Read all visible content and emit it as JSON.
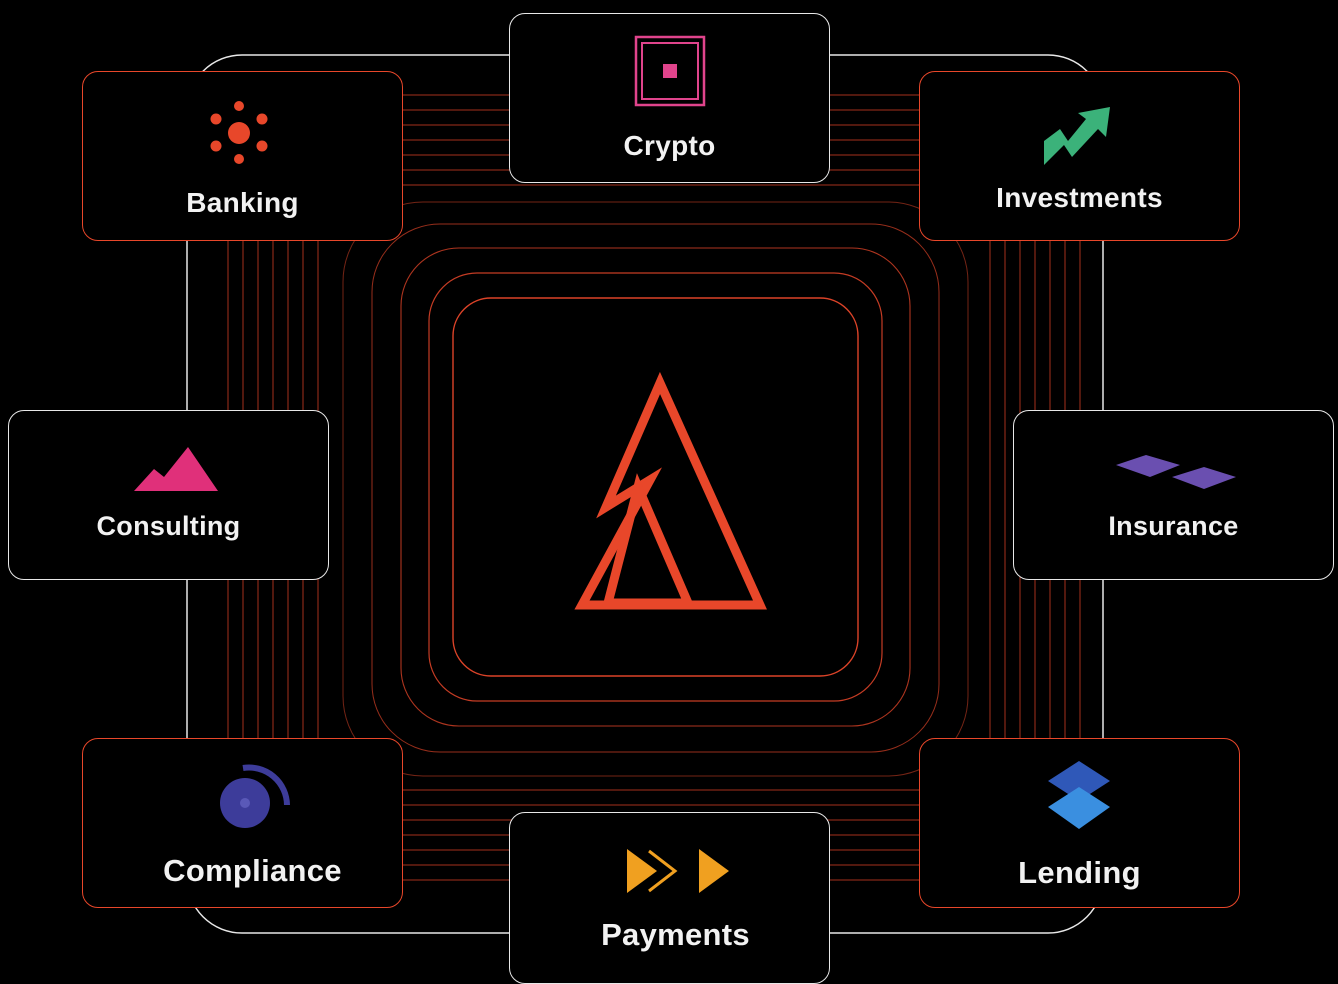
{
  "hub": {
    "logo_icon": "triangle-mark-icon",
    "accent_color": "#e8472a"
  },
  "nodes": [
    {
      "key": "crypto",
      "label": "Crypto",
      "icon": "nested-square-icon",
      "color": "#e0448c"
    },
    {
      "key": "banking",
      "label": "Banking",
      "icon": "sun-dots-icon",
      "color": "#e8472a"
    },
    {
      "key": "investments",
      "label": "Investments",
      "icon": "trend-arrow-icon",
      "color": "#3bb27a"
    },
    {
      "key": "consulting",
      "label": "Consulting",
      "icon": "mountain-icon",
      "color": "#e0307a"
    },
    {
      "key": "insurance",
      "label": "Insurance",
      "icon": "diamond-pair-icon",
      "color": "#6a4fb0"
    },
    {
      "key": "compliance",
      "label": "Compliance",
      "icon": "orbit-circle-icon",
      "color": "#3d3c9a"
    },
    {
      "key": "payments",
      "label": "Payments",
      "icon": "fast-forward-icon",
      "color": "#f0a020"
    },
    {
      "key": "lending",
      "label": "Lending",
      "icon": "stacked-diamonds-icon",
      "color": "#3a7fd6"
    }
  ],
  "line_colors": {
    "accent": "#e8472a",
    "neutral": "#e8e8e8"
  }
}
